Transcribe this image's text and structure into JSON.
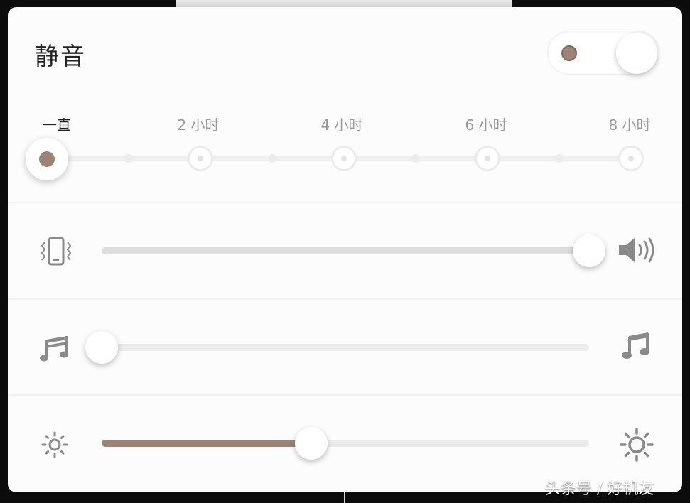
{
  "panel": {
    "title": "静音",
    "mute_toggle": {
      "on": true,
      "accent": "#9b8476"
    }
  },
  "timer": {
    "labels": [
      "一直",
      "2 小时",
      "4 小时",
      "6 小时",
      "8 小时"
    ],
    "selected_label": "一直"
  },
  "ringtone": {
    "left_icon": "vibrate-phone-icon",
    "right_icon": "speaker-volume-icon",
    "level": 1.0
  },
  "media": {
    "left_icon": "music-notes-low-icon",
    "right_icon": "music-notes-high-icon",
    "level": 0.0
  },
  "brightness": {
    "left_icon": "sun-small-icon",
    "right_icon": "sun-large-icon",
    "level": 0.43,
    "fill_color": "#9b8476"
  },
  "watermark": "头条号 / 好机友"
}
